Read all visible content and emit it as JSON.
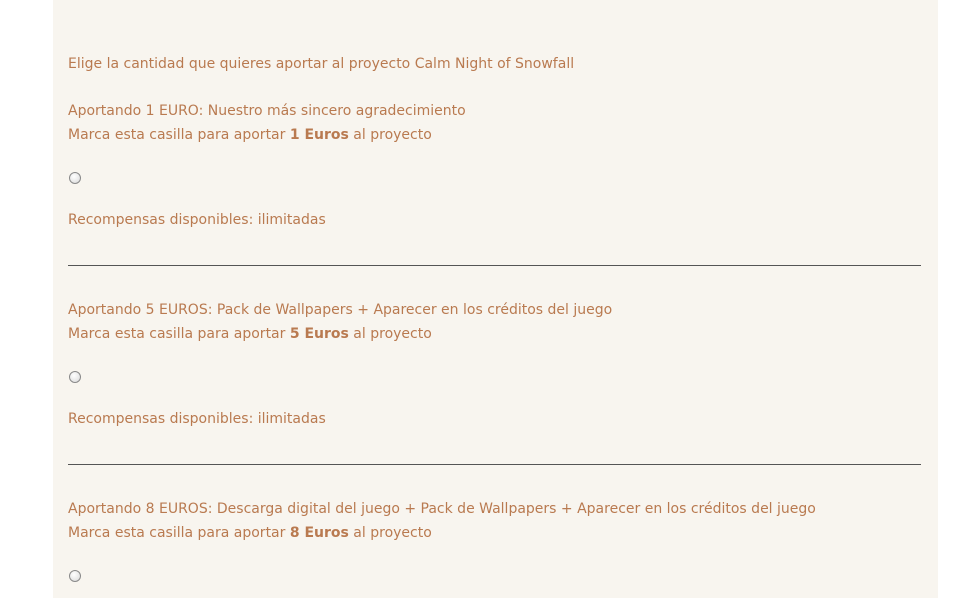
{
  "intro": "Elige la cantidad que quieres aportar al proyecto Calm Night of Snowfall",
  "tiers": [
    {
      "heading_prefix": "Aportando 1 EURO:",
      "heading_reward": " Nuestro más sincero agradecimiento",
      "mark_prefix": "Marca esta casilla para aportar ",
      "mark_amount": "1 Euros",
      "mark_suffix": " al proyecto",
      "available": "Recompensas disponibles: ilimitadas"
    },
    {
      "heading_prefix": "Aportando 5 EUROS:",
      "heading_reward": " Pack de Wallpapers + Aparecer en los créditos del juego",
      "mark_prefix": "Marca esta casilla para aportar ",
      "mark_amount": "5 Euros",
      "mark_suffix": " al proyecto",
      "available": "Recompensas disponibles: ilimitadas"
    },
    {
      "heading_prefix": "Aportando 8 EUROS:",
      "heading_reward": " Descarga digital del juego + Pack de Wallpapers + Aparecer en los créditos del juego",
      "mark_prefix": "Marca esta casilla para aportar ",
      "mark_amount": "8 Euros",
      "mark_suffix": " al proyecto"
    }
  ],
  "colors": {
    "text": "#b97a50",
    "panel_background": "#f8f5ef",
    "divider": "#555555"
  }
}
